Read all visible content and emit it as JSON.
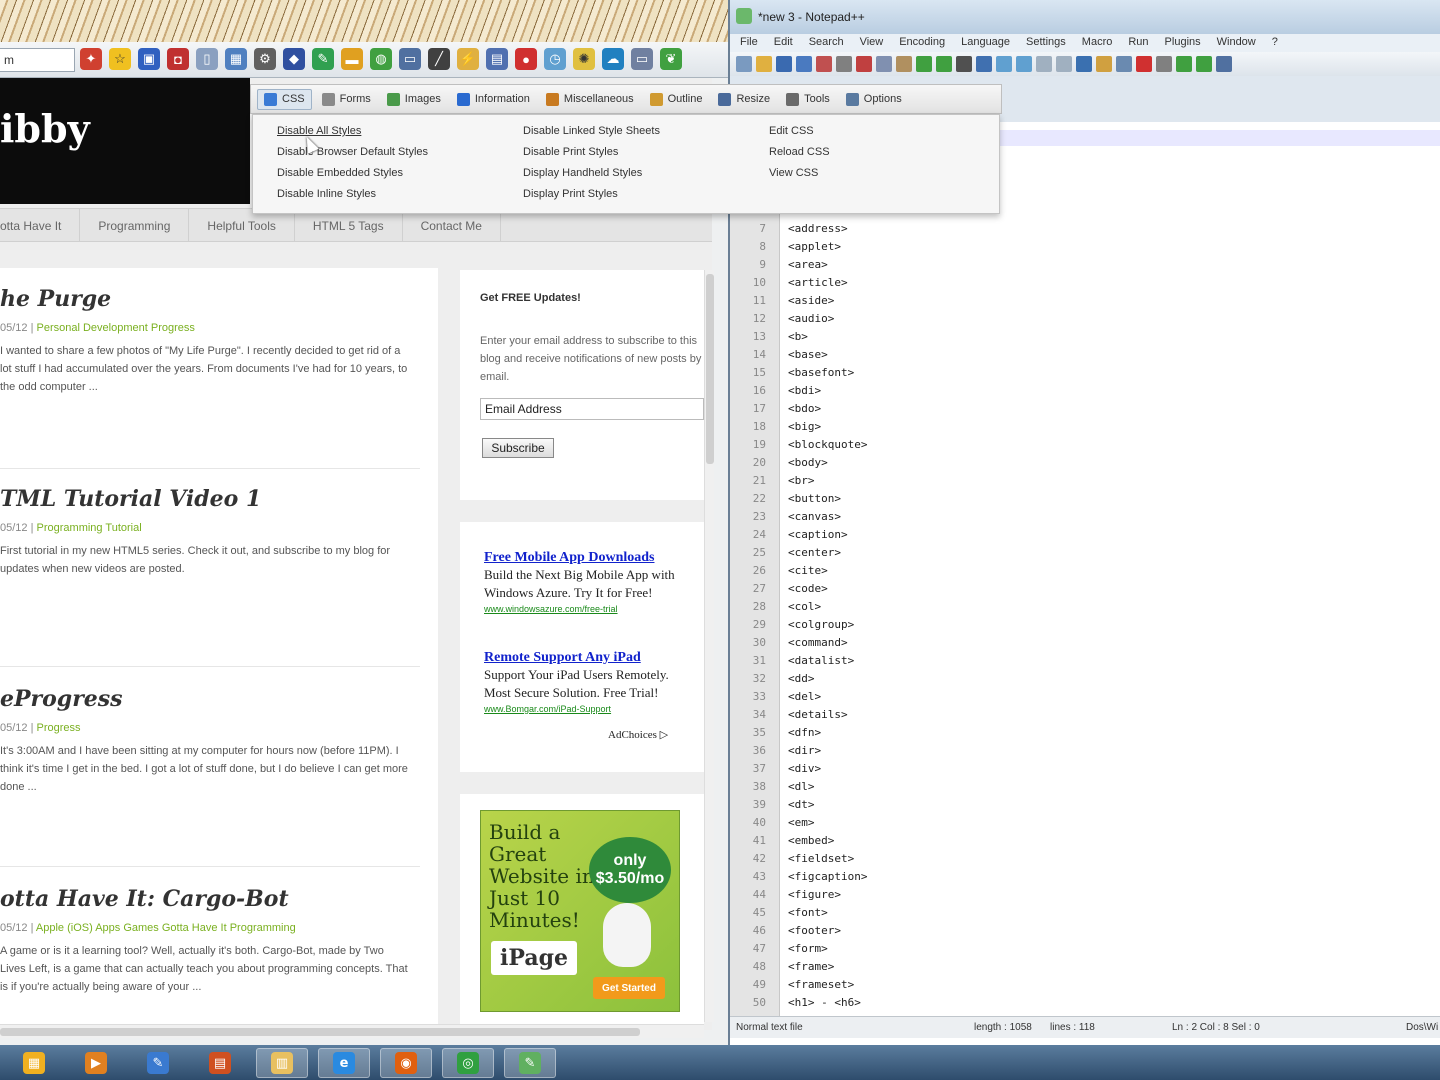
{
  "browser": {
    "address_text": "m",
    "site": {
      "title": "ibby",
      "nav": [
        "otta Have It",
        "Programming",
        "Helpful Tools",
        "HTML 5 Tags",
        "Contact Me"
      ],
      "posts": [
        {
          "title": "he Purge",
          "date": "05/12",
          "categories": "Personal Development Progress",
          "excerpt": "I wanted to share a few photos of \"My Life Purge\". I recently decided to get rid of a lot stuff I had accumulated over the years. From documents I've had for 10 years, to the odd computer ..."
        },
        {
          "title": "TML Tutorial Video 1",
          "date": "05/12",
          "categories": "Programming Tutorial",
          "excerpt": "First tutorial in my new HTML5 series. Check it out, and subscribe to my blog for updates when new videos are posted."
        },
        {
          "title": "eProgress",
          "date": "05/12",
          "categories": "Progress",
          "excerpt": "It's 3:00AM and I have been sitting at my computer for hours now (before 11PM). I think it's time I get in the bed. I got a lot of stuff done, but I do believe I can get more done ..."
        },
        {
          "title": "otta Have It: Cargo-Bot",
          "date": "05/12",
          "categories": "Apple (iOS) Apps Games Gotta Have It Programming",
          "excerpt": "A game or is it a learning tool? Well, actually it's both. Cargo-Bot, made by Two Lives Left, is a game that can actually teach you about programming concepts. That is if you're actually being aware of your ..."
        }
      ],
      "subscribe": {
        "title": "Get FREE Updates!",
        "text": "Enter your email address to subscribe to this blog and receive notifications of new posts by email.",
        "input_value": "Email Address",
        "button": "Subscribe"
      },
      "ads": [
        {
          "title": "Free Mobile App Downloads",
          "body": "Build the Next Big Mobile App with Windows Azure. Try It for Free!",
          "url": "www.windowsazure.com/free-trial"
        },
        {
          "title": "Remote Support Any iPad",
          "body": "Support Your iPad Users Remotely. Most Secure Solution. Free Trial!",
          "url": "www.Bomgar.com/iPad-Support"
        }
      ],
      "adchoices": "AdChoices ▷",
      "banner": {
        "text": "Build a Great Website in Just 10 Minutes!",
        "price": "only $3.50/mo",
        "logo": "iPage",
        "cta": "Get Started"
      }
    },
    "webdev_toolbar": {
      "items": [
        {
          "label": "CSS",
          "color": "#3a7bd5"
        },
        {
          "label": "Forms",
          "color": "#8a8a8a"
        },
        {
          "label": "Images",
          "color": "#4a9a4a"
        },
        {
          "label": "Information",
          "color": "#2a6ad0"
        },
        {
          "label": "Miscellaneous",
          "color": "#c87a20"
        },
        {
          "label": "Outline",
          "color": "#d09a30"
        },
        {
          "label": "Resize",
          "color": "#4a6a9a"
        },
        {
          "label": "Tools",
          "color": "#6a6a6a"
        },
        {
          "label": "Options",
          "color": "#5a7aa0"
        }
      ],
      "css_menu": {
        "col1": [
          "Disable All Styles",
          "Disable Browser Default Styles",
          "Disable Embedded Styles",
          "Disable Inline Styles"
        ],
        "col2": [
          "Disable Linked Style Sheets",
          "Disable Print Styles",
          "Display Handheld Styles",
          "Display Print Styles"
        ],
        "col3": [
          "Edit CSS",
          "Reload CSS",
          "View CSS"
        ]
      }
    }
  },
  "notepad": {
    "title": "*new 3 - Notepad++",
    "menus": [
      "File",
      "Edit",
      "Search",
      "View",
      "Encoding",
      "Language",
      "Settings",
      "Macro",
      "Run",
      "Plugins",
      "Window",
      "?"
    ],
    "lines": [
      {
        "n": "7",
        "t": "<address>"
      },
      {
        "n": "8",
        "t": "<applet>"
      },
      {
        "n": "9",
        "t": "<area>"
      },
      {
        "n": "10",
        "t": "<article>"
      },
      {
        "n": "11",
        "t": "<aside>"
      },
      {
        "n": "12",
        "t": "<audio>"
      },
      {
        "n": "13",
        "t": "<b>"
      },
      {
        "n": "14",
        "t": "<base>"
      },
      {
        "n": "15",
        "t": "<basefont>"
      },
      {
        "n": "16",
        "t": "<bdi>"
      },
      {
        "n": "17",
        "t": "<bdo>"
      },
      {
        "n": "18",
        "t": "<big>"
      },
      {
        "n": "19",
        "t": "<blockquote>"
      },
      {
        "n": "20",
        "t": "<body>"
      },
      {
        "n": "21",
        "t": "<br>"
      },
      {
        "n": "22",
        "t": "<button>"
      },
      {
        "n": "23",
        "t": "<canvas>"
      },
      {
        "n": "24",
        "t": "<caption>"
      },
      {
        "n": "25",
        "t": "<center>"
      },
      {
        "n": "26",
        "t": "<cite>"
      },
      {
        "n": "27",
        "t": "<code>"
      },
      {
        "n": "28",
        "t": "<col>"
      },
      {
        "n": "29",
        "t": "<colgroup>"
      },
      {
        "n": "30",
        "t": "<command>"
      },
      {
        "n": "31",
        "t": "<datalist>"
      },
      {
        "n": "32",
        "t": "<dd>"
      },
      {
        "n": "33",
        "t": "<del>"
      },
      {
        "n": "34",
        "t": "<details>"
      },
      {
        "n": "35",
        "t": "<dfn>"
      },
      {
        "n": "36",
        "t": "<dir>"
      },
      {
        "n": "37",
        "t": "<div>"
      },
      {
        "n": "38",
        "t": "<dl>"
      },
      {
        "n": "39",
        "t": "<dt>"
      },
      {
        "n": "40",
        "t": "<em>"
      },
      {
        "n": "41",
        "t": "<embed>"
      },
      {
        "n": "42",
        "t": "<fieldset>"
      },
      {
        "n": "43",
        "t": "<figcaption>"
      },
      {
        "n": "44",
        "t": "<figure>"
      },
      {
        "n": "45",
        "t": "<font>"
      },
      {
        "n": "46",
        "t": "<footer>"
      },
      {
        "n": "47",
        "t": "<form>"
      },
      {
        "n": "48",
        "t": "<frame>"
      },
      {
        "n": "49",
        "t": "<frameset>"
      },
      {
        "n": "50",
        "t": "<h1> - <h6>"
      }
    ],
    "status": {
      "type": "Normal text file",
      "length": "length : 1058",
      "lines": "lines : 118",
      "pos": "Ln : 2    Col : 8    Sel : 0",
      "eol": "Dos\\Wi"
    }
  },
  "taskbar": {
    "apps": [
      {
        "name": "windows-explorer",
        "glyph": "▦",
        "color": "#f0b020"
      },
      {
        "name": "media",
        "glyph": "▶",
        "color": "#e08020"
      },
      {
        "name": "paint",
        "glyph": "✎",
        "color": "#3a7ad0"
      },
      {
        "name": "powerpoint",
        "glyph": "▤",
        "color": "#d05020"
      },
      {
        "name": "folder",
        "glyph": "▥",
        "color": "#e8c060"
      },
      {
        "name": "internet-explorer",
        "glyph": "e",
        "color": "#2a8ae0"
      },
      {
        "name": "firefox",
        "glyph": "◉",
        "color": "#e06010"
      },
      {
        "name": "chrome",
        "glyph": "◎",
        "color": "#30a040"
      },
      {
        "name": "notepad-plus-plus",
        "glyph": "✎",
        "color": "#60b060"
      }
    ]
  }
}
